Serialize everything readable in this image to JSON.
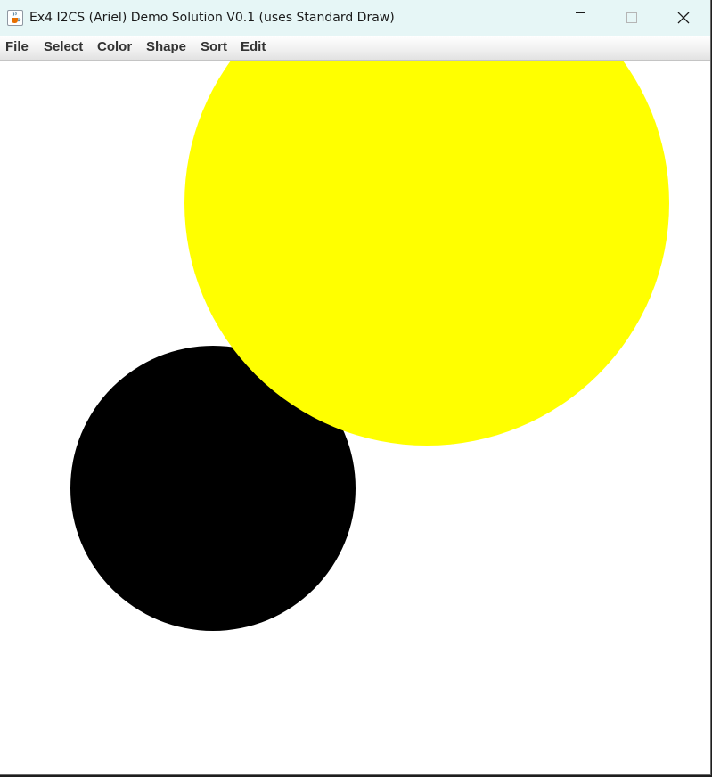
{
  "window": {
    "title": "Ex4 I2CS (Ariel) Demo Solution V0.1 (uses Standard Draw)",
    "app_icon": "java-coffee-cup-icon",
    "controls": [
      "minimize-icon",
      "maximize-icon",
      "close-icon"
    ]
  },
  "menu": {
    "items": [
      "File",
      "Select",
      "Color",
      "Shape",
      "Sort",
      "Edit"
    ]
  },
  "canvas": {
    "background": "#ffffff",
    "shapes": [
      {
        "type": "circle",
        "color": "#000000",
        "label": "black circle"
      },
      {
        "type": "circle",
        "color": "#ffff00",
        "label": "yellow circle"
      }
    ]
  }
}
